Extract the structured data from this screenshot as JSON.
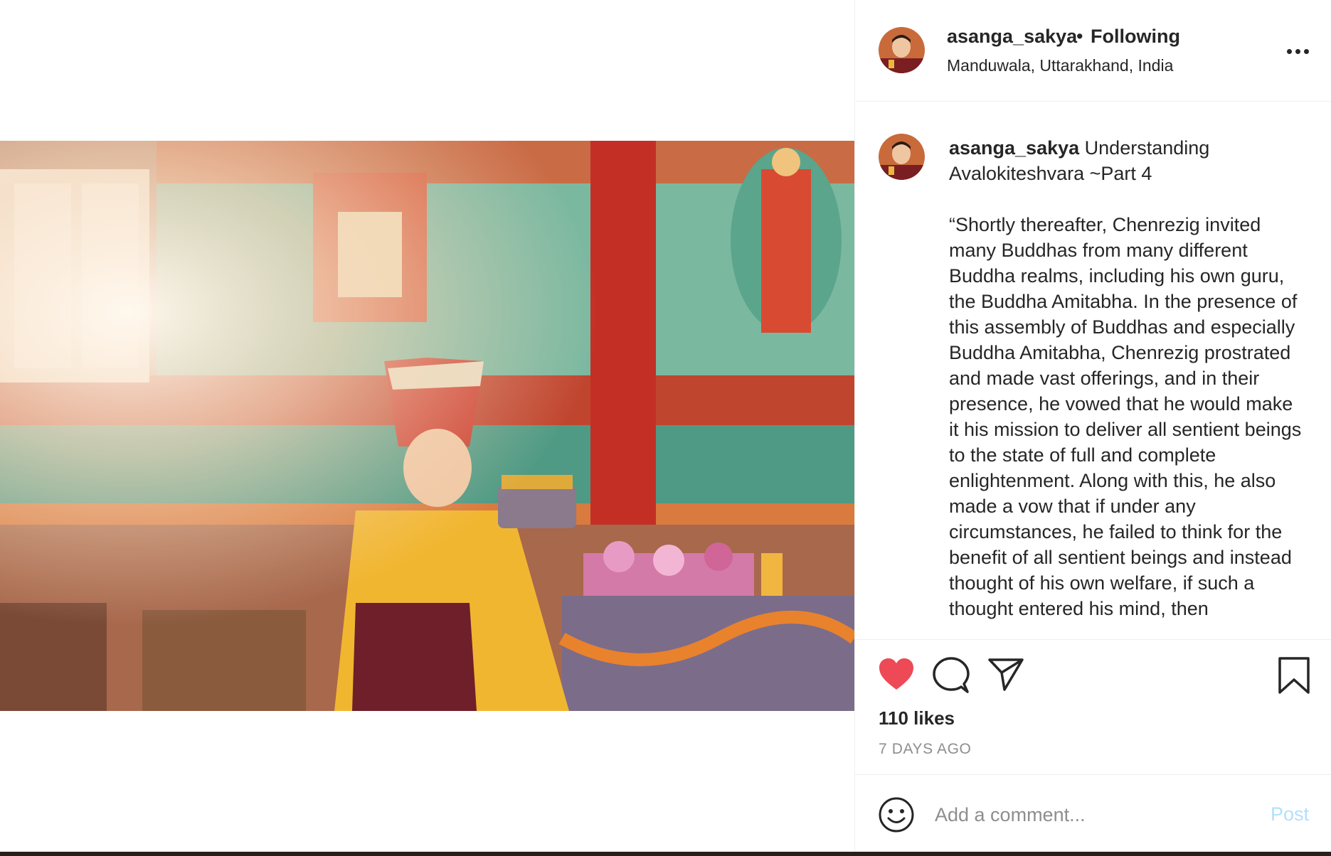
{
  "post": {
    "username": "asanga_sakya",
    "separator": "•",
    "follow_status": "Following",
    "location": "Manduwala, Uttarakhand, India",
    "media": {
      "description_icon": "photo-icon"
    }
  },
  "caption": {
    "username": "asanga_sakya",
    "title": "Understanding Avalokiteshvara ~Part 4",
    "body": "“Shortly thereafter, Chenrezig invited many Buddhas from many different Buddha realms, including his own guru, the Buddha Amitabha. In the presence of this assembly of Buddhas and especially Buddha Amitabha, Chenrezig prostrated and made vast offerings, and in their presence, he vowed that he would make it his mission to deliver all sentient beings to the state of full and complete enlightenment. Along with this, he also made a vow that if under any circumstances, he failed to think for the benefit of all sentient beings and instead thought of his own welfare, if such a thought entered his mind, then"
  },
  "actions": {
    "like_icon": "heart-filled-icon",
    "comment_icon": "comment-icon",
    "share_icon": "paper-plane-icon",
    "save_icon": "bookmark-icon",
    "likes": "110 likes",
    "timestamp": "7 DAYS AGO",
    "like_color": "#ed4956"
  },
  "comment": {
    "emoji_icon": "smiley-icon",
    "placeholder": "Add a comment...",
    "post_label": "Post",
    "post_color": "#b2dffc"
  },
  "more_icon": "more-options-icon"
}
